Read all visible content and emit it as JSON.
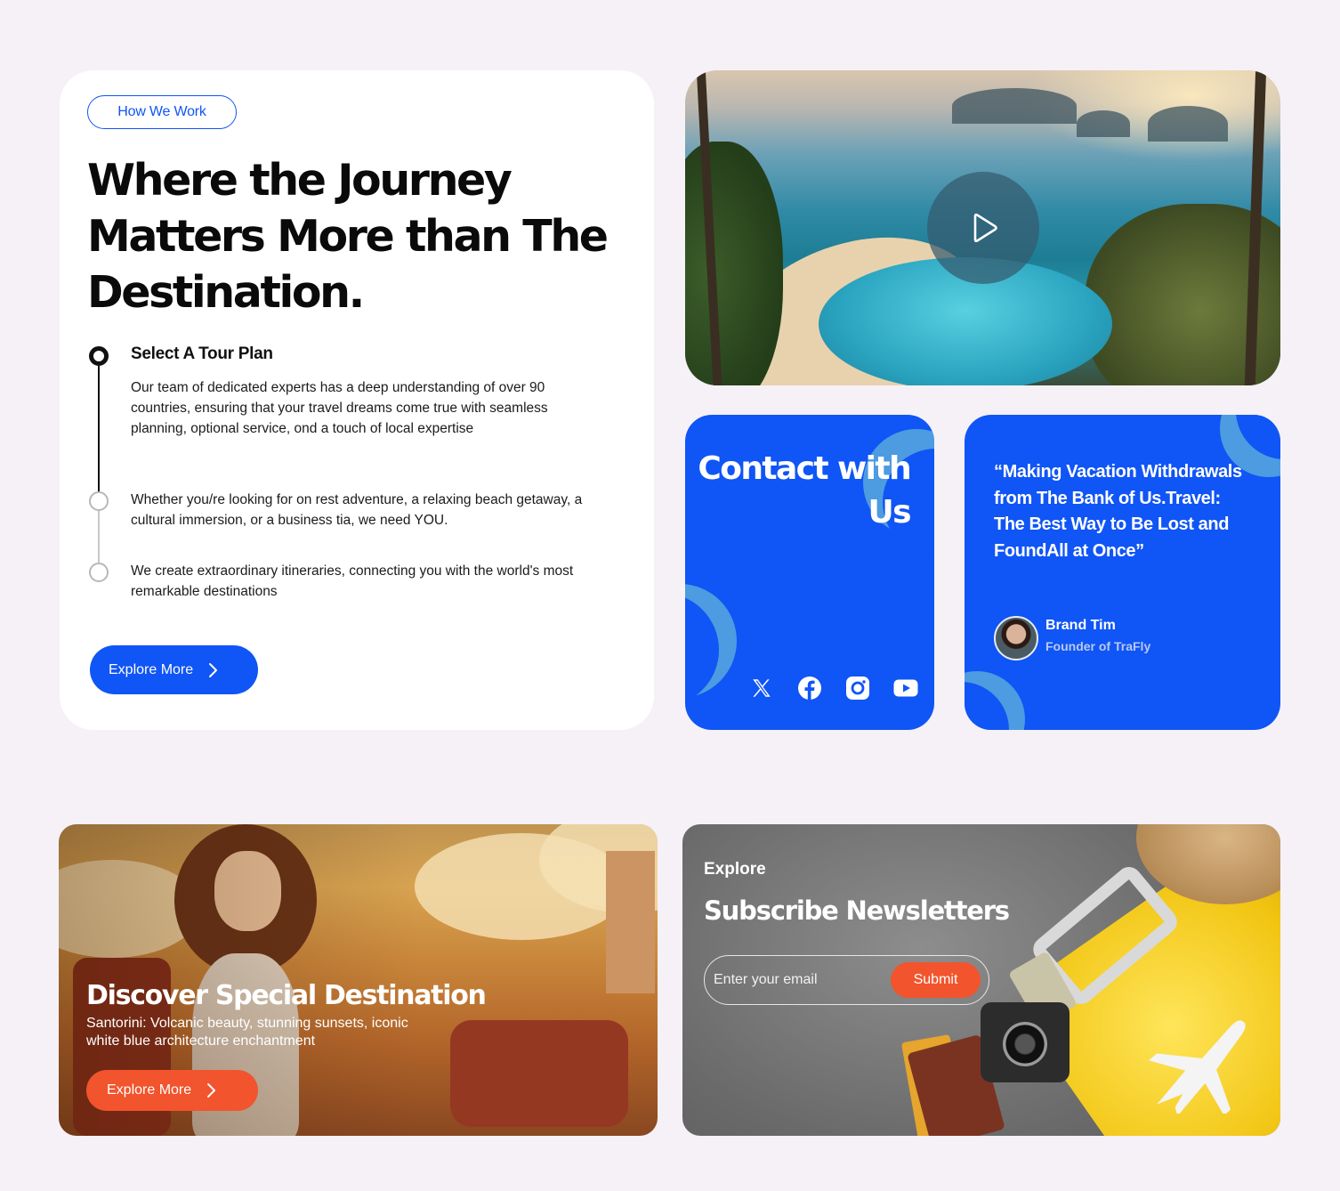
{
  "how_we_work": {
    "tag": "How We Work",
    "headline": "Where the Journey Matters More than The Destination.",
    "steps": [
      {
        "title": "Select A Tour Plan",
        "text": "Our team of dedicated experts has a deep understanding of over 90 countries, ensuring that your travel dreams come true with seamless planning, optional service, ond a touch of local expertise"
      },
      {
        "text": "Whether you/re looking for on rest adventure, a relaxing beach getaway, a cultural immersion, or a business tia, we need YOU."
      },
      {
        "text": "We create extraordinary itineraries, connecting you with the world's most remarkable destinations"
      }
    ],
    "button_label": "Explore More"
  },
  "video": {
    "play_icon": "play-icon"
  },
  "contact": {
    "title": "Contact with Us",
    "socials": [
      "x-icon",
      "facebook-icon",
      "instagram-icon",
      "youtube-icon"
    ]
  },
  "testimonial": {
    "quote": "“Making Vacation Withdrawals from The Bank of Us.Travel: The Best Way to Be Lost and FoundAll at Once”",
    "author_name": "Brand Tim",
    "author_role": "Founder of TraFly"
  },
  "discover": {
    "title": "Discover Special Destination",
    "text": "Santorini: Volcanic beauty, stunning sunsets, iconic white blue  architecture enchantment",
    "button_label": "Explore More"
  },
  "newsletter": {
    "kicker": "Explore",
    "title": "Subscribe Newsletters",
    "email_placeholder": "Enter your email",
    "submit_label": "Submit"
  },
  "colors": {
    "primary_blue": "#1055f5",
    "accent_orange": "#f2542d",
    "background": "#f5f1f7",
    "light_circle": "#4d9be0"
  }
}
